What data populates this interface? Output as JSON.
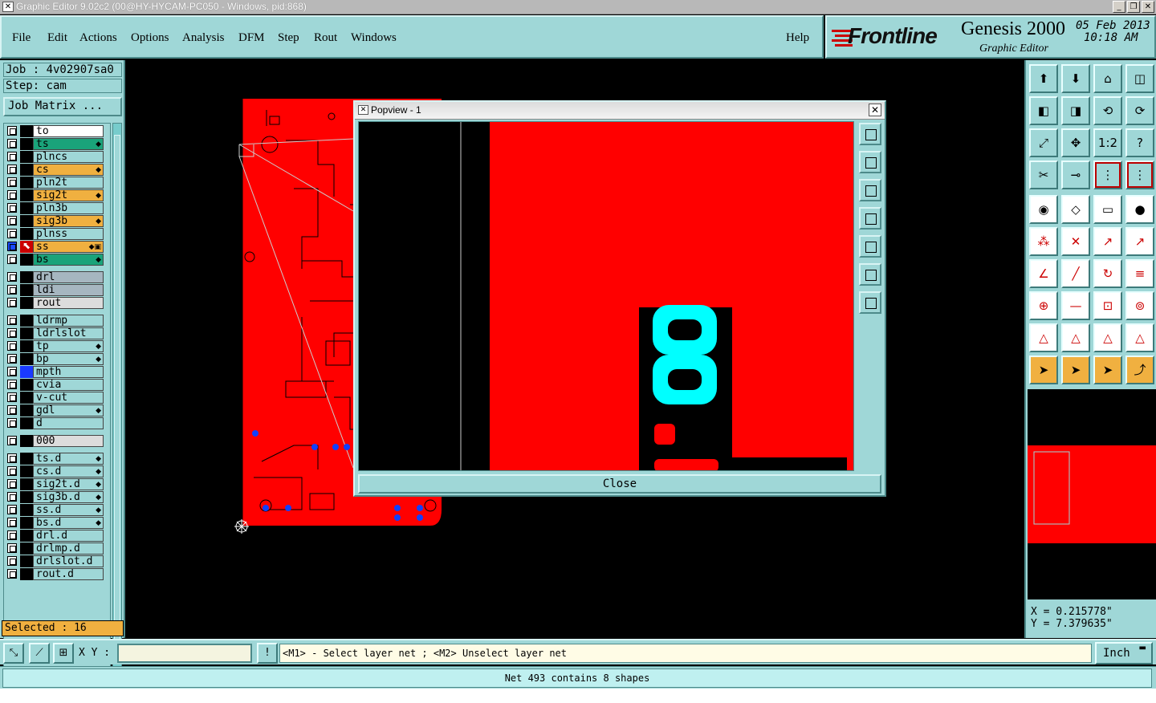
{
  "window": {
    "title": "Graphic Editor 9.02c2 (00@HY-HYCAM-PC050 - Windows, pid:868)",
    "buttons": [
      "_",
      "❐",
      "✕"
    ]
  },
  "menu": {
    "items": [
      "File",
      "Edit",
      "Actions",
      "Options",
      "Analysis",
      "DFM",
      "Step",
      "Rout",
      "Windows"
    ],
    "help": "Help"
  },
  "brand": {
    "logo": "Frontline",
    "product": "Genesis 2000",
    "subtitle": "Graphic Editor",
    "date": "05 Feb 2013",
    "time": "10:18 AM"
  },
  "left": {
    "job": "Job : 4v02907sa0",
    "step": "Step: cam",
    "job_matrix": "Job Matrix ...",
    "selected": "Selected : 16",
    "layers": [
      {
        "name": "to",
        "color": "#ffffff",
        "mark": false,
        "dot": ""
      },
      {
        "name": "ts",
        "color": "#1aa37a",
        "mark": false,
        "dot": "◆"
      },
      {
        "name": "plncs",
        "color": "#9fd7d7",
        "mark": false,
        "dot": ""
      },
      {
        "name": "cs",
        "color": "#f0b040",
        "mark": false,
        "dot": "◆"
      },
      {
        "name": "pln2t",
        "color": "#9fd7d7",
        "mark": false,
        "dot": ""
      },
      {
        "name": "sig2t",
        "color": "#f0b040",
        "mark": false,
        "dot": "◆"
      },
      {
        "name": "pln3b",
        "color": "#9fd7d7",
        "mark": false,
        "dot": ""
      },
      {
        "name": "sig3b",
        "color": "#f0b040",
        "mark": false,
        "dot": "◆"
      },
      {
        "name": "plnss",
        "color": "#9fd7d7",
        "mark": false,
        "dot": ""
      },
      {
        "name": "ss",
        "color": "#f0b040",
        "mark": true,
        "dot": "◆▣"
      },
      {
        "name": "bs",
        "color": "#1aa37a",
        "mark": false,
        "dot": "◆"
      },
      {
        "name": "drl",
        "color": "#a6b6c0",
        "mark": false,
        "dot": ""
      },
      {
        "name": "ldi",
        "color": "#a6b6c0",
        "mark": false,
        "dot": ""
      },
      {
        "name": "rout",
        "color": "#dcdcdc",
        "mark": false,
        "dot": ""
      },
      {
        "name": "ldrmp",
        "color": "#9fd7d7",
        "mark": false,
        "dot": ""
      },
      {
        "name": "ldrlslot",
        "color": "#9fd7d7",
        "mark": false,
        "dot": ""
      },
      {
        "name": "tp",
        "color": "#9fd7d7",
        "mark": false,
        "dot": "◆"
      },
      {
        "name": "bp",
        "color": "#9fd7d7",
        "mark": false,
        "dot": "◆"
      },
      {
        "name": "mpth",
        "color": "#9fd7d7",
        "mark": false,
        "dot": ""
      },
      {
        "name": "cvia",
        "color": "#9fd7d7",
        "mark": false,
        "dot": ""
      },
      {
        "name": "v-cut",
        "color": "#9fd7d7",
        "mark": false,
        "dot": ""
      },
      {
        "name": "gdl",
        "color": "#9fd7d7",
        "mark": false,
        "dot": "◆"
      },
      {
        "name": "d",
        "color": "#9fd7d7",
        "mark": false,
        "dot": ""
      },
      {
        "name": "000",
        "color": "#dcdcdc",
        "mark": false,
        "dot": ""
      },
      {
        "name": "ts.d",
        "color": "#9fd7d7",
        "mark": false,
        "dot": "◆"
      },
      {
        "name": "cs.d",
        "color": "#9fd7d7",
        "mark": false,
        "dot": "◆"
      },
      {
        "name": "sig2t.d",
        "color": "#9fd7d7",
        "mark": false,
        "dot": "◆"
      },
      {
        "name": "sig3b.d",
        "color": "#9fd7d7",
        "mark": false,
        "dot": "◆"
      },
      {
        "name": "ss.d",
        "color": "#9fd7d7",
        "mark": false,
        "dot": "◆"
      },
      {
        "name": "bs.d",
        "color": "#9fd7d7",
        "mark": false,
        "dot": "◆"
      },
      {
        "name": "drl.d",
        "color": "#9fd7d7",
        "mark": false,
        "dot": ""
      },
      {
        "name": "drlmp.d",
        "color": "#9fd7d7",
        "mark": false,
        "dot": ""
      },
      {
        "name": "drlslot.d",
        "color": "#9fd7d7",
        "mark": false,
        "dot": ""
      },
      {
        "name": "rout.d",
        "color": "#9fd7d7",
        "mark": false,
        "dot": ""
      }
    ]
  },
  "popview": {
    "title": "Popview - 1",
    "close_label": "Close"
  },
  "coords": {
    "x": "X = 0.215778\"",
    "y": "Y = 7.379635\""
  },
  "command": {
    "xy_label": "X Y :",
    "xy_value": "",
    "hint": "<M1> - Select layer net ; <M2> Unselect layer net",
    "unit": "Inch"
  },
  "status": {
    "message": "Net 493 contains 8 shapes"
  },
  "colors": {
    "panel": "#9fd7d7",
    "board": "#ff0000",
    "pad": "#00ffff",
    "selected": "#f0b040"
  }
}
